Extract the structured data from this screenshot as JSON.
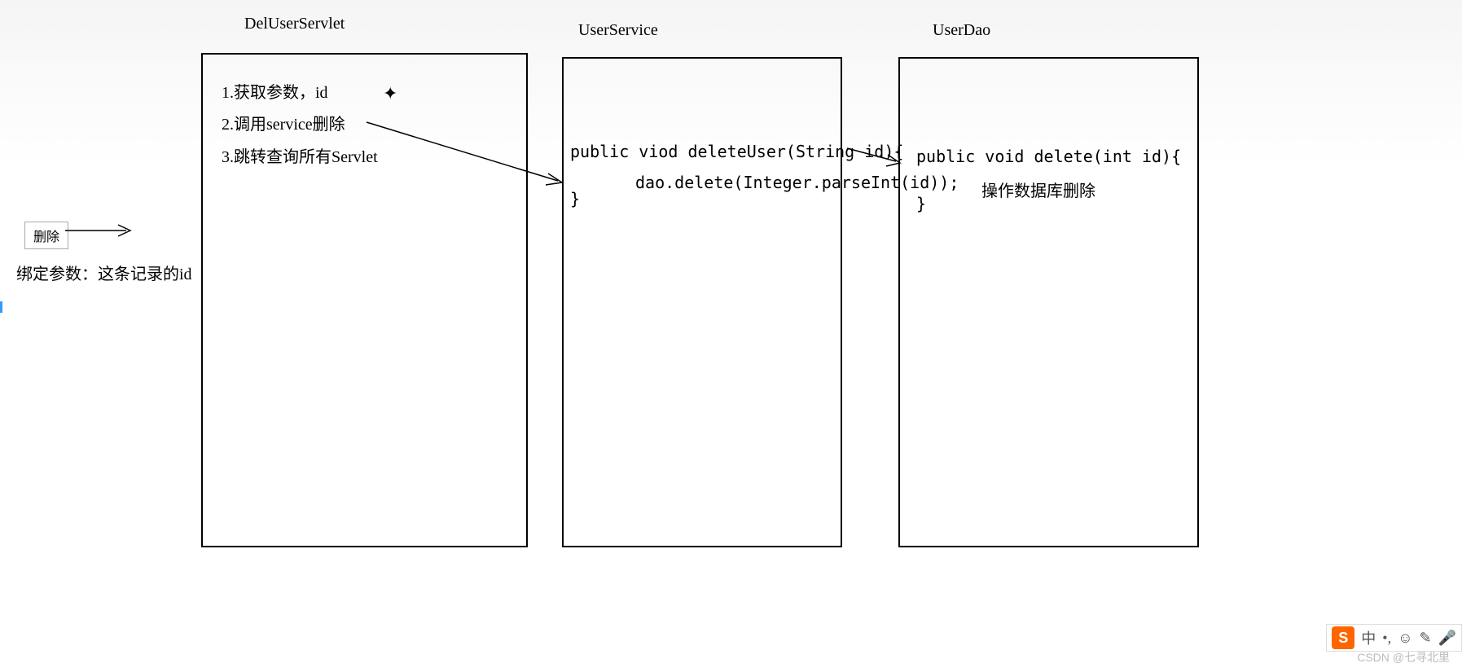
{
  "titles": {
    "servlet": "DelUserServlet",
    "service": "UserService",
    "dao": "UserDao"
  },
  "deleteButton": "删除",
  "bindNote": "绑定参数：这条记录的id",
  "servletSteps": {
    "s1": "1.获取参数，id",
    "s2": "2.调用service删除",
    "s3": "3.跳转查询所有Servlet"
  },
  "serviceCode": {
    "line1": "public viod deleteUser(String id){",
    "line2": "dao.delete(Integer.parseInt(id));",
    "line3": "}"
  },
  "daoCode": {
    "line1": "public void delete(int id){",
    "line2": "操作数据库删除",
    "line3": "}"
  },
  "watermark": "CSDN @七寻北里",
  "ime": {
    "logo": "S",
    "lang": "中"
  }
}
